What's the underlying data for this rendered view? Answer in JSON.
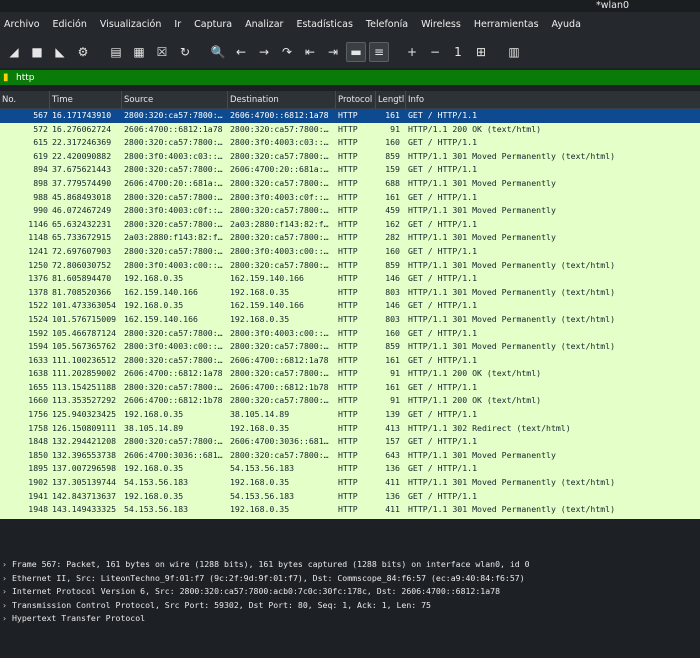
{
  "window": {
    "title": "*wlan0"
  },
  "menu": [
    "Archivo",
    "Edición",
    "Visualización",
    "Ir",
    "Captura",
    "Analizar",
    "Estadísticas",
    "Telefonía",
    "Wireless",
    "Herramientas",
    "Ayuda"
  ],
  "toolbar": {
    "icons": [
      "shark-fin-start-icon",
      "stop-square-icon",
      "shark-fin-restart-icon",
      "gear-options-icon",
      "open-file-icon",
      "save-file-icon",
      "close-file-icon",
      "reload-file-icon",
      "search-icon",
      "back-arrow-icon",
      "forward-arrow-icon",
      "goto-packet-icon",
      "first-packet-icon",
      "last-packet-icon",
      "autoscroll-icon",
      "colorize-icon",
      "zoom-in-icon",
      "zoom-out-icon",
      "normal-size-icon",
      "resize-columns-icon",
      "layout-icon"
    ],
    "glyphs": [
      "◢",
      "■",
      "◣",
      "⚙",
      "▤",
      "▦",
      "☒",
      "↻",
      "🔍",
      "←",
      "→",
      "↷",
      "⇤",
      "⇥",
      "▬",
      "≡",
      "+",
      "−",
      "1",
      "⊞",
      "▥"
    ]
  },
  "filter": {
    "value": "http"
  },
  "columns": [
    "No.",
    "Time",
    "Source",
    "Destination",
    "Protocol",
    "Lengtl",
    "Info"
  ],
  "packets": [
    {
      "no": "567",
      "time": "16.171743910",
      "src": "2800:320:ca57:7800:…",
      "dst": "2606:4700::6812:1a78",
      "proto": "HTTP",
      "len": "161",
      "info": "GET / HTTP/1.1"
    },
    {
      "no": "572",
      "time": "16.276062724",
      "src": "2606:4700::6812:1a78",
      "dst": "2800:320:ca57:7800:…",
      "proto": "HTTP",
      "len": "91",
      "info": "HTTP/1.1 200 OK  (text/html)"
    },
    {
      "no": "615",
      "time": "22.317246369",
      "src": "2800:320:ca57:7800:…",
      "dst": "2800:3f0:4003:c03::…",
      "proto": "HTTP",
      "len": "160",
      "info": "GET / HTTP/1.1"
    },
    {
      "no": "619",
      "time": "22.420090882",
      "src": "2800:3f0:4003:c03::…",
      "dst": "2800:320:ca57:7800:…",
      "proto": "HTTP",
      "len": "859",
      "info": "HTTP/1.1 301 Moved Permanently  (text/html)"
    },
    {
      "no": "894",
      "time": "37.675621443",
      "src": "2800:320:ca57:7800:…",
      "dst": "2606:4700:20::681a:…",
      "proto": "HTTP",
      "len": "159",
      "info": "GET / HTTP/1.1"
    },
    {
      "no": "898",
      "time": "37.779574490",
      "src": "2606:4700:20::681a:…",
      "dst": "2800:320:ca57:7800:…",
      "proto": "HTTP",
      "len": "688",
      "info": "HTTP/1.1 301 Moved Permanently"
    },
    {
      "no": "988",
      "time": "45.868493018",
      "src": "2800:320:ca57:7800:…",
      "dst": "2800:3f0:4003:c0f::…",
      "proto": "HTTP",
      "len": "161",
      "info": "GET / HTTP/1.1"
    },
    {
      "no": "990",
      "time": "46.072467249",
      "src": "2800:3f0:4003:c0f::…",
      "dst": "2800:320:ca57:7800:…",
      "proto": "HTTP",
      "len": "459",
      "info": "HTTP/1.1 301 Moved Permanently"
    },
    {
      "no": "1146",
      "time": "65.632432231",
      "src": "2800:320:ca57:7800:…",
      "dst": "2a03:2880:f143:82:f…",
      "proto": "HTTP",
      "len": "162",
      "info": "GET / HTTP/1.1"
    },
    {
      "no": "1148",
      "time": "65.733672915",
      "src": "2a03:2880:f143:82:f…",
      "dst": "2800:320:ca57:7800:…",
      "proto": "HTTP",
      "len": "282",
      "info": "HTTP/1.1 301 Moved Permanently"
    },
    {
      "no": "1241",
      "time": "72.697607903",
      "src": "2800:320:ca57:7800:…",
      "dst": "2800:3f0:4003:c00::…",
      "proto": "HTTP",
      "len": "160",
      "info": "GET / HTTP/1.1"
    },
    {
      "no": "1250",
      "time": "72.806030752",
      "src": "2800:3f0:4003:c00::…",
      "dst": "2800:320:ca57:7800:…",
      "proto": "HTTP",
      "len": "859",
      "info": "HTTP/1.1 301 Moved Permanently  (text/html)"
    },
    {
      "no": "1376",
      "time": "81.605894470",
      "src": "192.168.0.35",
      "dst": "162.159.140.166",
      "proto": "HTTP",
      "len": "146",
      "info": "GET / HTTP/1.1"
    },
    {
      "no": "1378",
      "time": "81.708520366",
      "src": "162.159.140.166",
      "dst": "192.168.0.35",
      "proto": "HTTP",
      "len": "803",
      "info": "HTTP/1.1 301 Moved Permanently  (text/html)"
    },
    {
      "no": "1522",
      "time": "101.473363054",
      "src": "192.168.0.35",
      "dst": "162.159.140.166",
      "proto": "HTTP",
      "len": "146",
      "info": "GET / HTTP/1.1"
    },
    {
      "no": "1524",
      "time": "101.576715009",
      "src": "162.159.140.166",
      "dst": "192.168.0.35",
      "proto": "HTTP",
      "len": "803",
      "info": "HTTP/1.1 301 Moved Permanently  (text/html)"
    },
    {
      "no": "1592",
      "time": "105.466787124",
      "src": "2800:320:ca57:7800:…",
      "dst": "2800:3f0:4003:c00::…",
      "proto": "HTTP",
      "len": "160",
      "info": "GET / HTTP/1.1"
    },
    {
      "no": "1594",
      "time": "105.567365762",
      "src": "2800:3f0:4003:c00::…",
      "dst": "2800:320:ca57:7800:…",
      "proto": "HTTP",
      "len": "859",
      "info": "HTTP/1.1 301 Moved Permanently  (text/html)"
    },
    {
      "no": "1633",
      "time": "111.100236512",
      "src": "2800:320:ca57:7800:…",
      "dst": "2606:4700::6812:1a78",
      "proto": "HTTP",
      "len": "161",
      "info": "GET / HTTP/1.1"
    },
    {
      "no": "1638",
      "time": "111.202859002",
      "src": "2606:4700::6812:1a78",
      "dst": "2800:320:ca57:7800:…",
      "proto": "HTTP",
      "len": "91",
      "info": "HTTP/1.1 200 OK  (text/html)"
    },
    {
      "no": "1655",
      "time": "113.154251188",
      "src": "2800:320:ca57:7800:…",
      "dst": "2606:4700::6812:1b78",
      "proto": "HTTP",
      "len": "161",
      "info": "GET / HTTP/1.1"
    },
    {
      "no": "1660",
      "time": "113.353527292",
      "src": "2606:4700::6812:1b78",
      "dst": "2800:320:ca57:7800:…",
      "proto": "HTTP",
      "len": "91",
      "info": "HTTP/1.1 200 OK  (text/html)"
    },
    {
      "no": "1756",
      "time": "125.940323425",
      "src": "192.168.0.35",
      "dst": "38.105.14.89",
      "proto": "HTTP",
      "len": "139",
      "info": "GET / HTTP/1.1"
    },
    {
      "no": "1758",
      "time": "126.150809111",
      "src": "38.105.14.89",
      "dst": "192.168.0.35",
      "proto": "HTTP",
      "len": "413",
      "info": "HTTP/1.1 302 Redirect  (text/html)"
    },
    {
      "no": "1848",
      "time": "132.294421208",
      "src": "2800:320:ca57:7800:…",
      "dst": "2606:4700:3036::681…",
      "proto": "HTTP",
      "len": "157",
      "info": "GET / HTTP/1.1"
    },
    {
      "no": "1850",
      "time": "132.396553738",
      "src": "2606:4700:3036::681…",
      "dst": "2800:320:ca57:7800:…",
      "proto": "HTTP",
      "len": "643",
      "info": "HTTP/1.1 301 Moved Permanently"
    },
    {
      "no": "1895",
      "time": "137.007296598",
      "src": "192.168.0.35",
      "dst": "54.153.56.183",
      "proto": "HTTP",
      "len": "136",
      "info": "GET / HTTP/1.1"
    },
    {
      "no": "1902",
      "time": "137.305139744",
      "src": "54.153.56.183",
      "dst": "192.168.0.35",
      "proto": "HTTP",
      "len": "411",
      "info": "HTTP/1.1 301 Moved Permanently  (text/html)"
    },
    {
      "no": "1941",
      "time": "142.843713637",
      "src": "192.168.0.35",
      "dst": "54.153.56.183",
      "proto": "HTTP",
      "len": "136",
      "info": "GET / HTTP/1.1"
    },
    {
      "no": "1948",
      "time": "143.149433325",
      "src": "54.153.56.183",
      "dst": "192.168.0.35",
      "proto": "HTTP",
      "len": "411",
      "info": "HTTP/1.1 301 Moved Permanently  (text/html)"
    }
  ],
  "details": [
    "Frame 567: Packet, 161 bytes on wire (1288 bits), 161 bytes captured (1288 bits) on interface wlan0, id 0",
    "Ethernet II, Src: LiteonTechno_9f:01:f7 (9c:2f:9d:9f:01:f7), Dst: Commscope_84:f6:57 (ec:a9:40:84:f6:57)",
    "Internet Protocol Version 6, Src: 2800:320:ca57:7800:acb0:7c0c:30fc:178c, Dst: 2606:4700::6812:1a78",
    "Transmission Control Protocol, Src Port: 59302, Dst Port: 80, Seq: 1, Ack: 1, Len: 75",
    "Hypertext Transfer Protocol"
  ],
  "colors": {
    "row_bg": "#e4ffc7",
    "selected_bg": "#0d4a8f",
    "filter_bg": "#0a7b08",
    "dark_bg": "#1d2125"
  }
}
